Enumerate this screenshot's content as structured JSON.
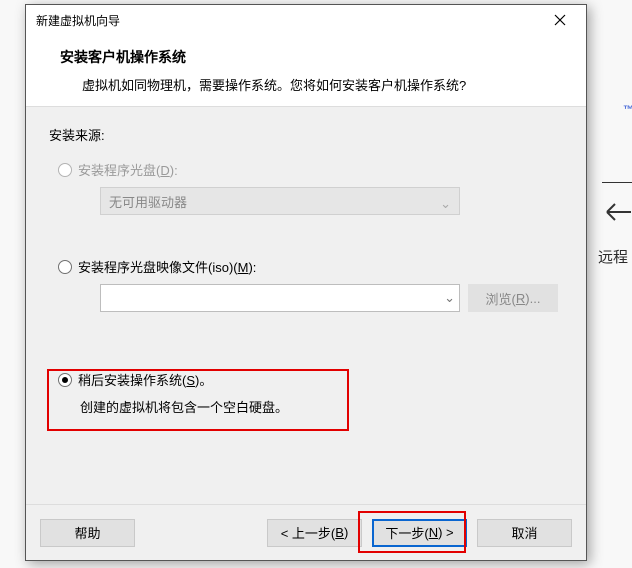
{
  "window": {
    "title": "新建虚拟机向导"
  },
  "header": {
    "heading": "安装客户机操作系统",
    "subtitle": "虚拟机如同物理机，需要操作系统。您将如何安装客户机操作系统?"
  },
  "content": {
    "source_label": "安装来源:",
    "opt_disc": {
      "label_pre": "安装程序光盘(",
      "hotkey": "D",
      "label_post": "):"
    },
    "combo_placeholder": "无可用驱动器",
    "opt_iso": {
      "label_pre": "安装程序光盘映像文件(iso)(",
      "hotkey": "M",
      "label_post": "):"
    },
    "browse": {
      "label_pre": "浏览(",
      "hotkey": "R",
      "label_post": ")..."
    },
    "opt_later": {
      "label_pre": "稍后安装操作系统(",
      "hotkey": "S",
      "label_post": ")。",
      "sub": "创建的虚拟机将包含一个空白硬盘。"
    }
  },
  "buttons": {
    "help": "帮助",
    "back_pre": "< 上一步(",
    "back_hot": "B",
    "back_post": ")",
    "next_pre": "下一步(",
    "next_hot": "N",
    "next_post": ") >",
    "cancel": "取消"
  },
  "background": {
    "tm": "™",
    "remote": "远程"
  }
}
